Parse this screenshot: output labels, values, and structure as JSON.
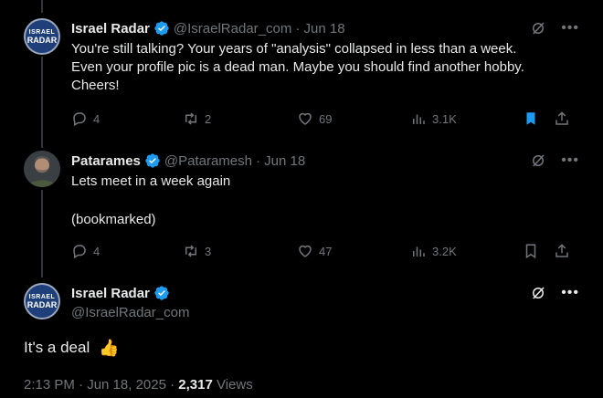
{
  "tweet1": {
    "name": "Israel Radar",
    "handle": "@IsraelRadar_com",
    "date": "· Jun 18",
    "avatar_text_top": "ISRAEL",
    "avatar_text_bottom": "RADAR",
    "text_lines": [
      "You're still talking? Your years of \"analysis\" collapsed in less than a week.",
      "Even your profile pic is a dead man. Maybe you should find another hobby.",
      "Cheers!"
    ],
    "replies": "4",
    "reposts": "2",
    "likes": "69",
    "views": "3.1K",
    "bookmarked": true
  },
  "tweet2": {
    "name": "Patarames",
    "handle": "@Pataramesh",
    "date": "· Jun 18",
    "text_line1": "Lets meet in a week again",
    "text_line2": "(bookmarked)",
    "replies": "4",
    "reposts": "3",
    "likes": "47",
    "views": "3.2K",
    "bookmarked": false
  },
  "tweet3": {
    "name": "Israel Radar",
    "handle": "@IsraelRadar_com",
    "avatar_text_top": "ISRAEL",
    "avatar_text_bottom": "RADAR",
    "text": "It's a deal",
    "emoji": "👍",
    "timestamp": "2:13 PM · Jun 18, 2025 · ",
    "views_count": "2,317",
    "views_label": " Views"
  },
  "colors": {
    "background": "#000000",
    "text": "#e7e9ea",
    "muted": "#71767b",
    "verified": "#1d9bf0",
    "bookmark_active": "#1d9bf0"
  }
}
